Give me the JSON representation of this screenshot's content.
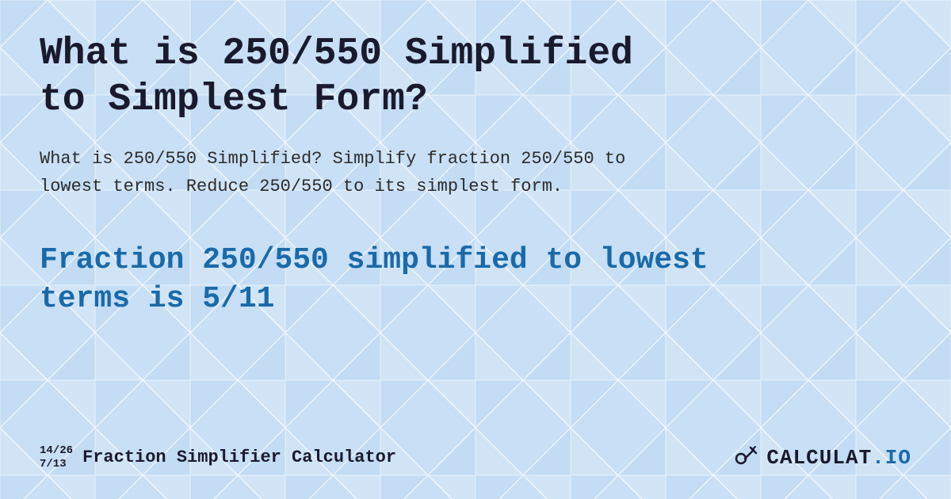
{
  "background": {
    "color": "#c8dff5"
  },
  "header": {
    "title": "What is 250/550 Simplified to Simplest Form?"
  },
  "description": {
    "text": "What is 250/550 Simplified? Simplify fraction 250/550 to lowest terms. Reduce 250/550 to its simplest form."
  },
  "result": {
    "text": "Fraction 250/550 simplified to lowest terms is 5/11"
  },
  "footer": {
    "fraction_top": "14/26",
    "fraction_bottom": "7/13",
    "title": "Fraction Simplifier Calculator",
    "logo_text": "CALCULAT.IO"
  }
}
